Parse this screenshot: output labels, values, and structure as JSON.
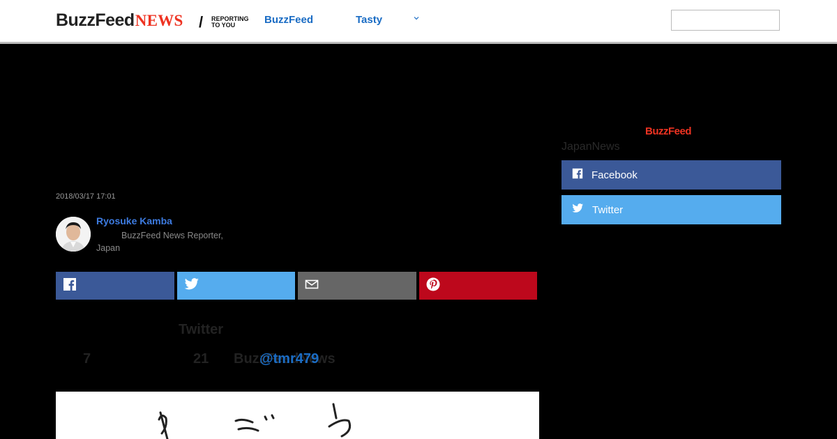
{
  "header": {
    "logo_main": "BuzzFeed",
    "logo_news": "NEWS",
    "logo_slash": "/",
    "logo_tag_line1": "REPORTING",
    "logo_tag_line2": "TO YOU",
    "nav": [
      "BuzzFeed",
      "Tasty"
    ],
    "search_placeholder": ""
  },
  "article": {
    "date": "2018/03/17 17:01",
    "author": {
      "name": "Ryosuke Kamba",
      "role_line1": "BuzzFeed News Reporter,",
      "role_line2": "Japan"
    },
    "share_icons": [
      "facebook-icon",
      "twitter-icon",
      "email-icon",
      "pinterest-icon"
    ],
    "twitter_heading": "Twitter",
    "stat_a": "7",
    "stat_b": "21",
    "bfn_partial": "BuzzFeedNews",
    "twitter_handle": "@tmr479"
  },
  "sidebar": {
    "logo": "BuzzFeed",
    "label": "JapanNews",
    "buttons": [
      {
        "label": "Facebook",
        "icon": "facebook-icon"
      },
      {
        "label": "Twitter",
        "icon": "twitter-icon"
      }
    ]
  },
  "colors": {
    "facebook": "#3b5998",
    "twitter": "#55acee",
    "email": "#666666",
    "pinterest": "#bd081c",
    "link_blue": "#1a6cc4",
    "brand_red": "#ee3322"
  }
}
